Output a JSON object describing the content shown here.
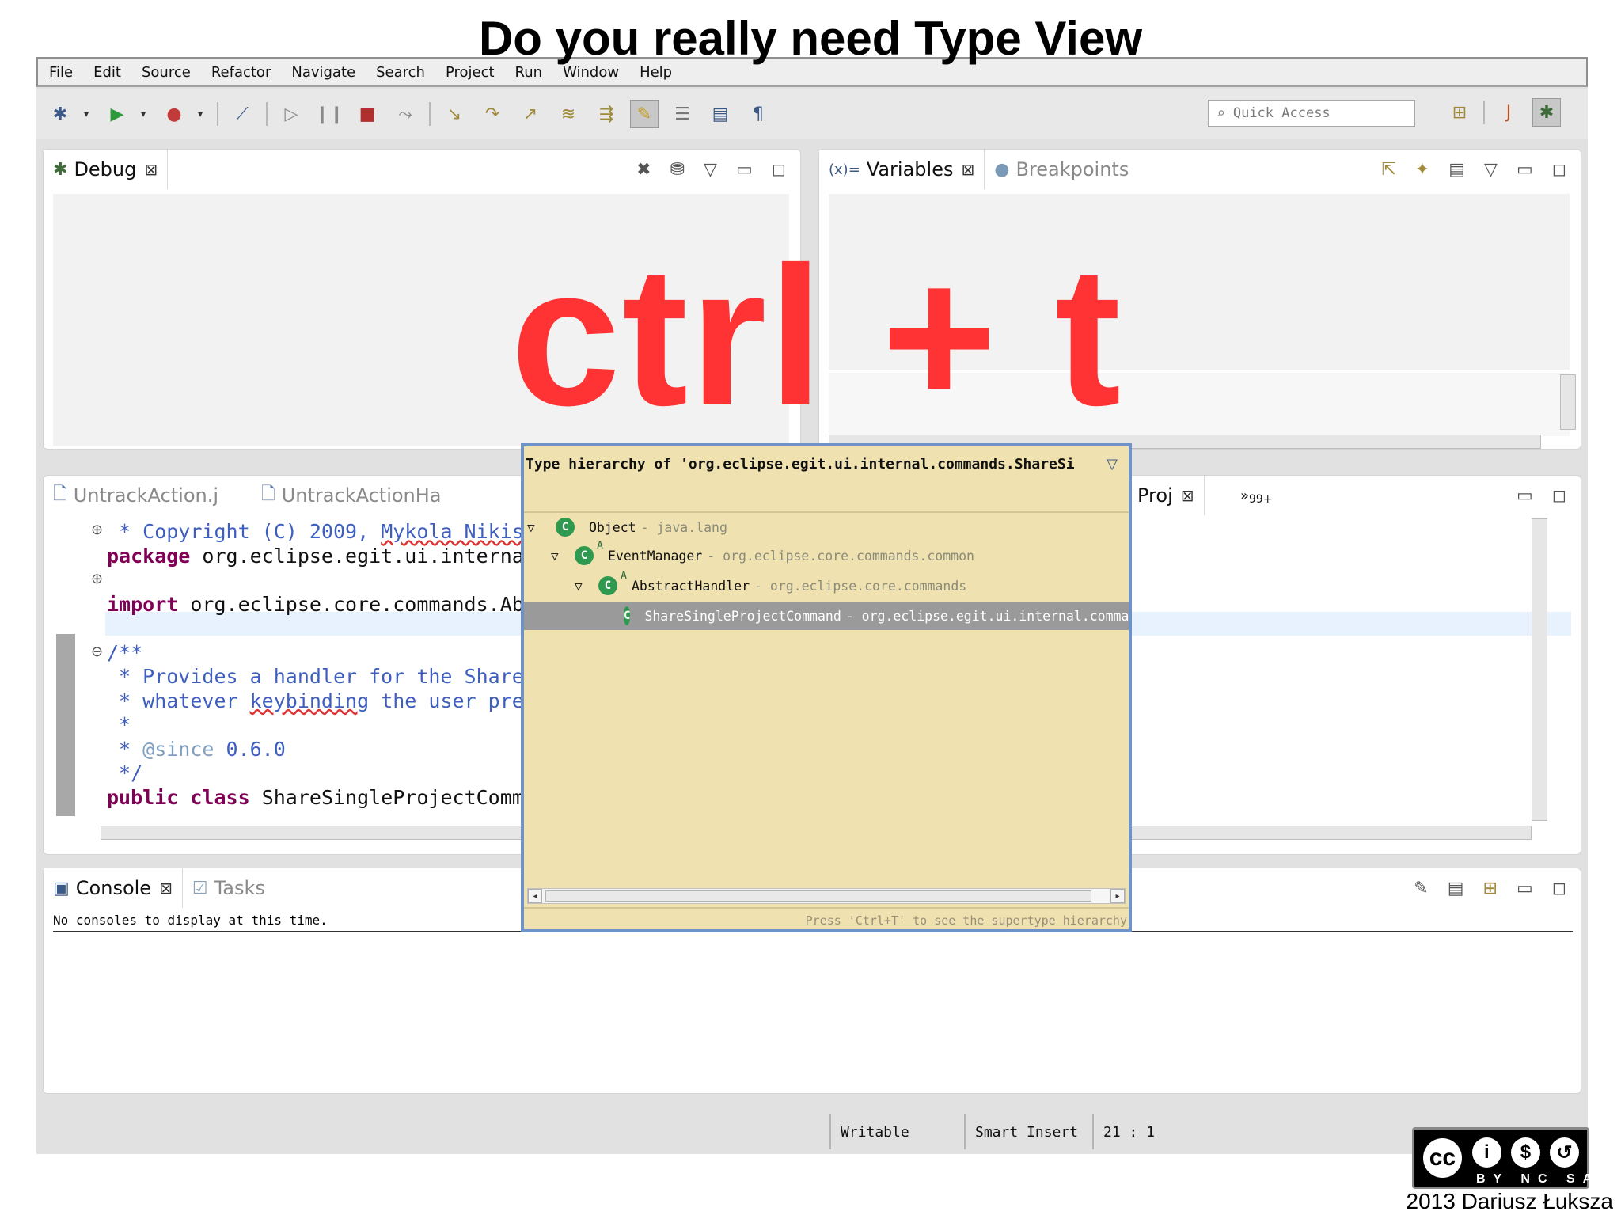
{
  "slide": {
    "title": "Do you really need Type View",
    "shortcut": "ctrl + t",
    "credit": "2013 Dariusz Łuksza",
    "license_labels": "BY NC SA"
  },
  "menu": [
    "File",
    "Edit",
    "Source",
    "Refactor",
    "Navigate",
    "Search",
    "Project",
    "Run",
    "Window",
    "Help"
  ],
  "toolbar": {
    "quick_access_placeholder": "Quick Access"
  },
  "debug_view": {
    "tab": "Debug"
  },
  "variables_view": {
    "tabs": [
      "Variables",
      "Breakpoints"
    ]
  },
  "editor": {
    "tabs": [
      "UntrackAction.j",
      "UntrackActionHa",
      "Proj"
    ],
    "overflow_count": "99+",
    "lines": {
      "l1_prefix": " * Copyright (C) 2009, ",
      "l1_author": "Mykola Nikis",
      "l2_kw": "package",
      "l2_rest": " org.eclipse.egit.ui.interna",
      "l3_kw": "import",
      "l3_rest": " org.eclipse.core.commands.Ab",
      "l4": "/**",
      "l5": " * Provides a handler for the Share",
      "l6_prefix": " * whatever ",
      "l6_word": "keybinding",
      "l6_rest": " the user pre",
      "l7": " *",
      "l8_prefix": " * ",
      "l8_tag": "@since",
      "l8_rest": " 0.6.0",
      "l9": " */",
      "l10_kw1": "public",
      "l10_kw2": "class",
      "l10_rest": " ShareSingleProjectComm"
    }
  },
  "console_view": {
    "tabs": [
      "Console",
      "Tasks"
    ],
    "message": "No consoles to display at this time."
  },
  "type_hierarchy_popup": {
    "title": "Type hierarchy of 'org.eclipse.egit.ui.internal.commands.ShareSi",
    "rows": [
      {
        "name": "Object",
        "package": "- java.lang"
      },
      {
        "name": "EventManager",
        "package": "- org.eclipse.core.commands.common"
      },
      {
        "name": "AbstractHandler",
        "package": "- org.eclipse.core.commands"
      },
      {
        "name": "ShareSingleProjectCommand",
        "package": "- org.eclipse.egit.ui.internal.comma"
      }
    ],
    "status": "Press 'Ctrl+T' to see the supertype hierarchy"
  },
  "statusbar": {
    "writable": "Writable",
    "insert_mode": "Smart Insert",
    "position": "21 : 1"
  },
  "colors": {
    "shortcut": "#ff3333",
    "popup_bg": "#efe1b0",
    "popup_border": "#6f93c9",
    "keyword": "#7f0055",
    "comment": "#3f5fbf"
  }
}
